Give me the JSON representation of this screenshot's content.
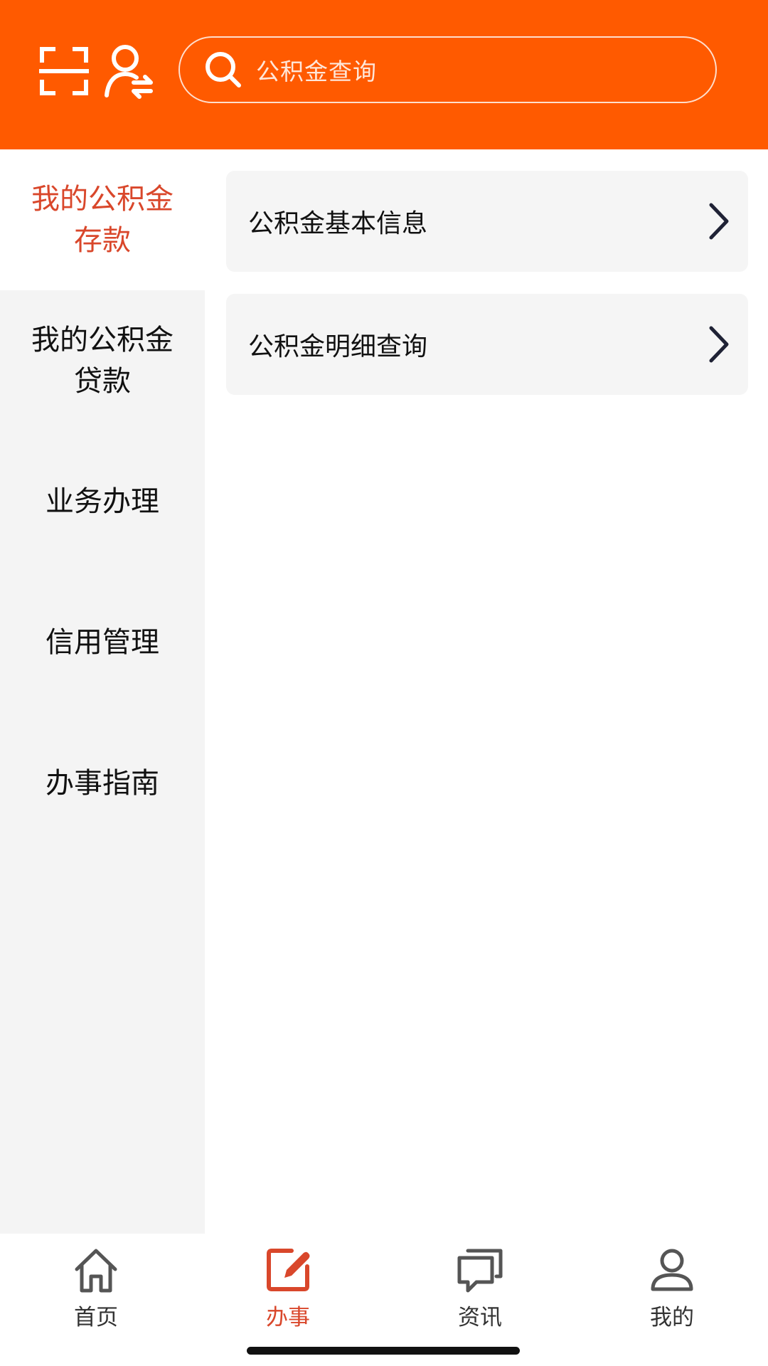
{
  "header": {
    "background": "#FF5A00",
    "scan_icon": "scan-icon",
    "user_switch_icon": "user-switch-icon",
    "search": {
      "icon": "search-icon",
      "placeholder": "公积金查询"
    }
  },
  "sidebar": {
    "items": [
      {
        "label": "我的公积金\n存款",
        "active": true
      },
      {
        "label": "我的公积金\n贷款",
        "active": false
      },
      {
        "label": "业务办理",
        "active": false
      },
      {
        "label": "信用管理",
        "active": false
      },
      {
        "label": "办事指南",
        "active": false
      }
    ]
  },
  "content": {
    "items": [
      {
        "label": "公积金基本信息",
        "icon": "chevron-right-icon"
      },
      {
        "label": "公积金明细查询",
        "icon": "chevron-right-icon"
      }
    ]
  },
  "tabbar": {
    "tabs": [
      {
        "label": "首页",
        "icon": "home-icon",
        "active": false
      },
      {
        "label": "办事",
        "icon": "edit-icon",
        "active": true
      },
      {
        "label": "资讯",
        "icon": "chat-icon",
        "active": false
      },
      {
        "label": "我的",
        "icon": "profile-icon",
        "active": false
      }
    ]
  },
  "colors": {
    "accent": "#FF5A00",
    "active_text": "#D9472B",
    "sidebar_bg": "#F4F4F4",
    "card_bg": "#F5F5F5"
  }
}
